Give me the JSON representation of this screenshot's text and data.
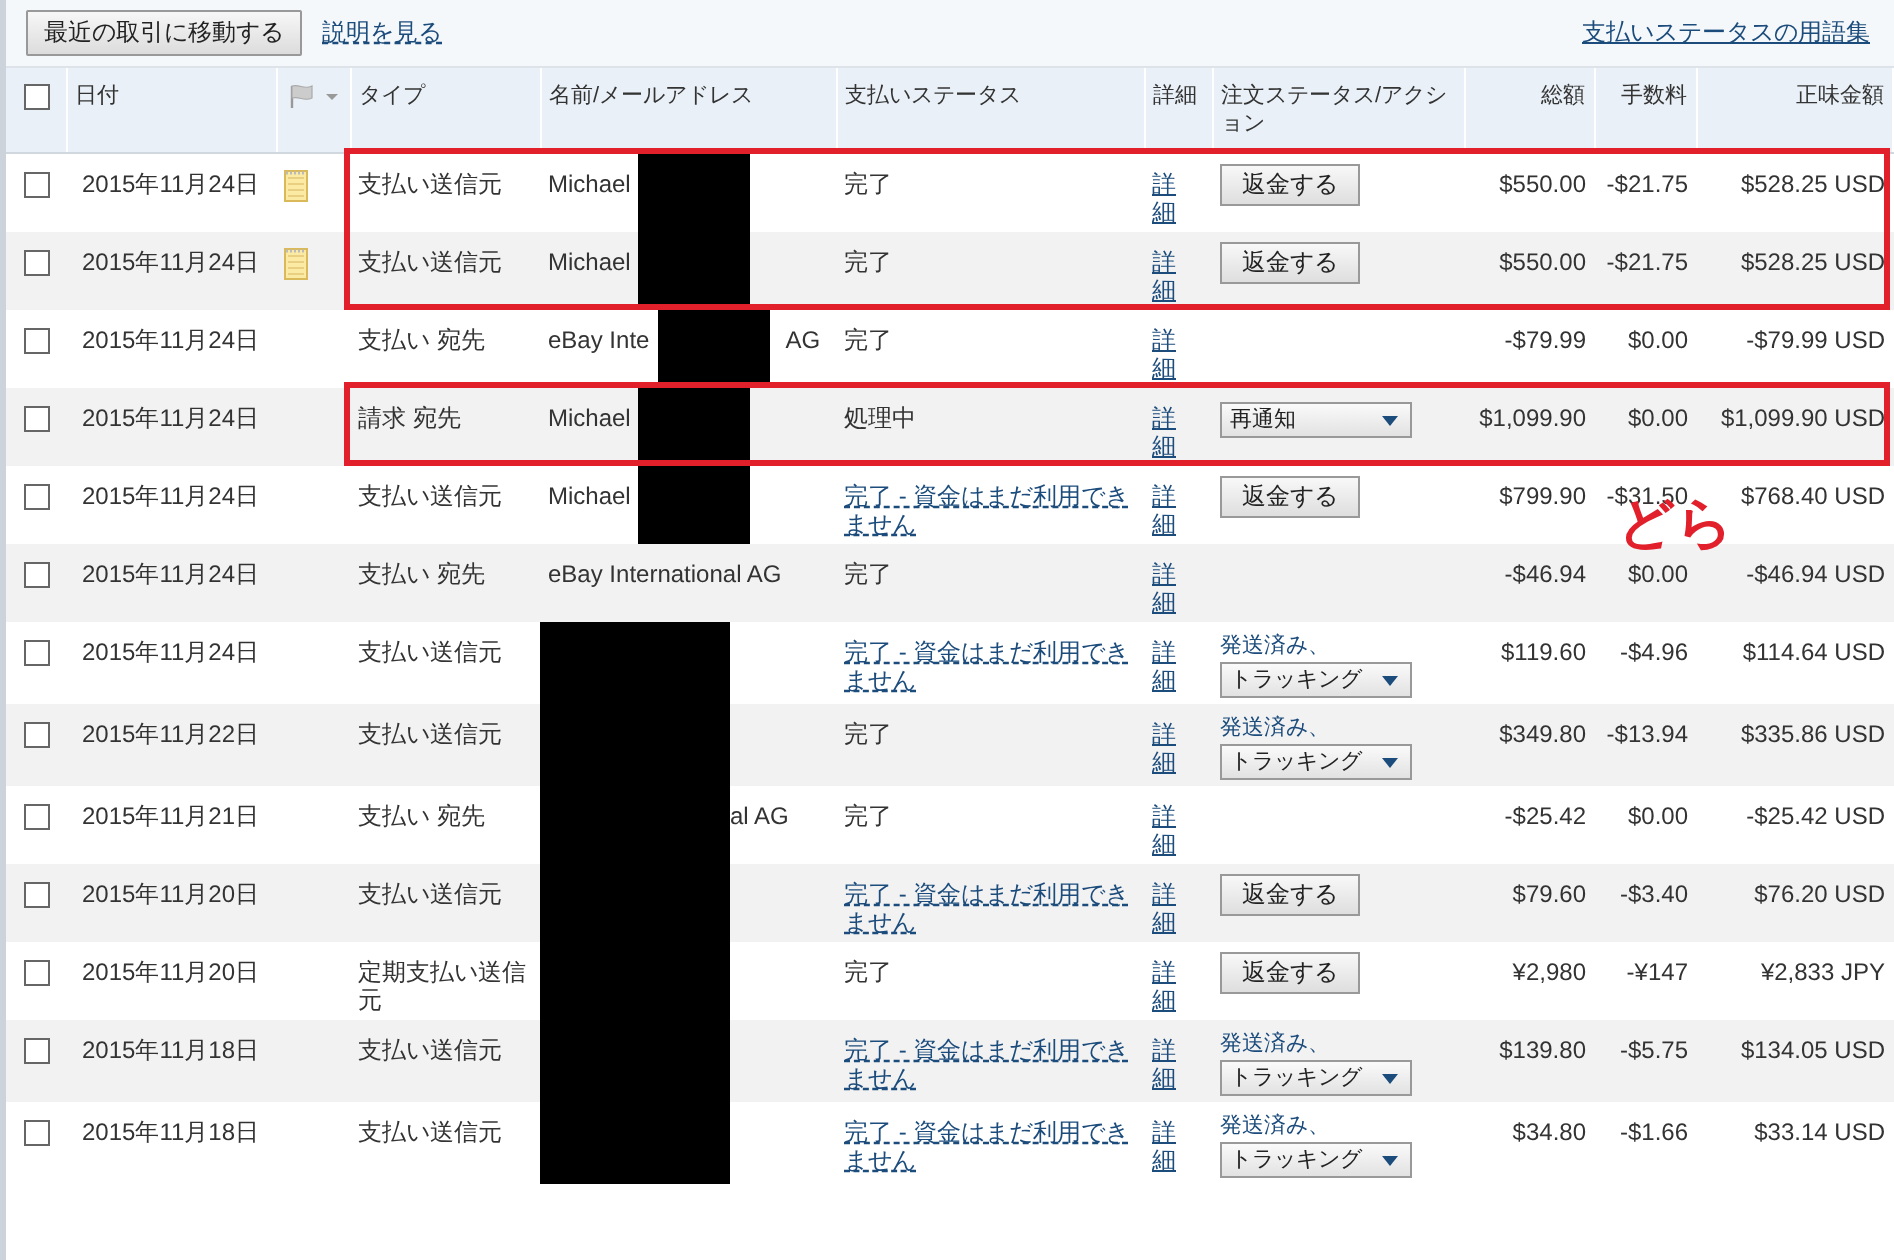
{
  "toolbar": {
    "recent_button": "最近の取引に移動する",
    "help_link": "説明を見る",
    "glossary_link": "支払いステータスの用語集"
  },
  "table": {
    "select_all": {
      "checked": false
    },
    "columns": [
      "日付",
      "タイプ",
      "名前/メールアドレス",
      "支払いステータス",
      "詳細",
      "注文ステータス/アクション",
      "総額",
      "手数料",
      "正味金額"
    ],
    "rows": [
      {
        "highlight": true,
        "checked": false,
        "date": "2015年11月24日",
        "note": true,
        "type": "支払い送信元",
        "name": [
          {
            "kind": "text",
            "text": "Michael"
          },
          {
            "kind": "redacted"
          }
        ],
        "status": {
          "text": "完了",
          "link": false
        },
        "details": "詳細",
        "action": {
          "kind": "button",
          "label": "返金する"
        },
        "gross": "$550.00",
        "fee": "-$21.75",
        "net": "$528.25 USD"
      },
      {
        "highlight": true,
        "checked": false,
        "date": "2015年11月24日",
        "note": true,
        "type": "支払い送信元",
        "name": [
          {
            "kind": "text",
            "text": "Michael"
          },
          {
            "kind": "redacted"
          }
        ],
        "status": {
          "text": "完了",
          "link": false
        },
        "details": "詳細",
        "action": {
          "kind": "button",
          "label": "返金する"
        },
        "gross": "$550.00",
        "fee": "-$21.75",
        "net": "$528.25 USD"
      },
      {
        "highlight": false,
        "checked": false,
        "date": "2015年11月24日",
        "note": false,
        "type": "支払い 宛先",
        "name": [
          {
            "kind": "text",
            "text": "eBay Inte"
          },
          {
            "kind": "redacted"
          },
          {
            "kind": "text",
            "text": "AG"
          }
        ],
        "status": {
          "text": "完了",
          "link": false
        },
        "details": "詳細",
        "gross": "-$79.99",
        "fee": "$0.00",
        "net": "-$79.99 USD"
      },
      {
        "highlight": true,
        "checked": false,
        "date": "2015年11月24日",
        "note": false,
        "type": "請求 宛先",
        "name": [
          {
            "kind": "text",
            "text": "Michael"
          },
          {
            "kind": "redacted"
          }
        ],
        "status": {
          "text": "処理中",
          "link": false
        },
        "details": "詳細",
        "action": {
          "kind": "dropdown",
          "label": "再通知"
        },
        "gross": "$1,099.90",
        "fee": "$0.00",
        "net": "$1,099.90 USD"
      },
      {
        "highlight": false,
        "checked": false,
        "date": "2015年11月24日",
        "note": false,
        "type": "支払い送信元",
        "name": [
          {
            "kind": "text",
            "text": "Michael"
          },
          {
            "kind": "redacted"
          }
        ],
        "status": {
          "text": "完了 - 資金はまだ利用できません",
          "link": true
        },
        "details": "詳細",
        "action": {
          "kind": "button",
          "label": "返金する"
        },
        "gross": "$799.90",
        "fee": "-$31.50",
        "net": "$768.40 USD"
      },
      {
        "highlight": false,
        "checked": false,
        "date": "2015年11月24日",
        "note": false,
        "type": "支払い 宛先",
        "name": [
          {
            "kind": "text",
            "text": "eBay International AG"
          }
        ],
        "status": {
          "text": "完了",
          "link": false
        },
        "details": "詳細",
        "gross": "-$46.94",
        "fee": "$0.00",
        "net": "-$46.94 USD"
      },
      {
        "highlight": false,
        "checked": false,
        "date": "2015年11月24日",
        "note": false,
        "type": "支払い送信元",
        "name": [
          {
            "kind": "redacted"
          }
        ],
        "status": {
          "text": "完了 - 資金はまだ利用できません",
          "link": true
        },
        "details": "詳細",
        "action": {
          "kind": "shipped",
          "label": "発送済み、",
          "select": "トラッキング"
        },
        "gross": "$119.60",
        "fee": "-$4.96",
        "net": "$114.64 USD"
      },
      {
        "highlight": false,
        "checked": false,
        "date": "2015年11月22日",
        "note": false,
        "type": "支払い送信元",
        "name": [
          {
            "kind": "redacted"
          }
        ],
        "status": {
          "text": "完了",
          "link": false
        },
        "details": "詳細",
        "action": {
          "kind": "shipped",
          "label": "発送済み、",
          "select": "トラッキング"
        },
        "gross": "$349.80",
        "fee": "-$13.94",
        "net": "$335.86 USD"
      },
      {
        "highlight": false,
        "checked": false,
        "date": "2015年11月21日",
        "note": false,
        "type": "支払い 宛先",
        "name": [
          {
            "kind": "redacted"
          },
          {
            "kind": "text",
            "text": "al AG"
          }
        ],
        "status": {
          "text": "完了",
          "link": false
        },
        "details": "詳細",
        "gross": "-$25.42",
        "fee": "$0.00",
        "net": "-$25.42 USD"
      },
      {
        "highlight": false,
        "checked": false,
        "date": "2015年11月20日",
        "note": false,
        "type": "支払い送信元",
        "name": [
          {
            "kind": "redacted"
          }
        ],
        "status": {
          "text": "完了 - 資金はまだ利用できません",
          "link": true
        },
        "details": "詳細",
        "action": {
          "kind": "button",
          "label": "返金する"
        },
        "gross": "$79.60",
        "fee": "-$3.40",
        "net": "$76.20 USD"
      },
      {
        "highlight": false,
        "checked": false,
        "date": "2015年11月20日",
        "note": false,
        "type": "定期支払い送信元",
        "name": [
          {
            "kind": "redacted"
          }
        ],
        "status": {
          "text": "完了",
          "link": false
        },
        "details": "詳細",
        "action": {
          "kind": "button",
          "label": "返金する"
        },
        "gross": "¥2,980",
        "fee": "-¥147",
        "net": "¥2,833 JPY"
      },
      {
        "highlight": false,
        "checked": false,
        "date": "2015年11月18日",
        "note": false,
        "type": "支払い送信元",
        "name": [
          {
            "kind": "redacted"
          }
        ],
        "status": {
          "text": "完了 - 資金はまだ利用できません",
          "link": true
        },
        "details": "詳細",
        "action": {
          "kind": "shipped",
          "label": "発送済み、",
          "select": "トラッキング"
        },
        "gross": "$139.80",
        "fee": "-$5.75",
        "net": "$134.05 USD"
      },
      {
        "highlight": false,
        "checked": false,
        "date": "2015年11月18日",
        "note": false,
        "type": "支払い送信元",
        "name": [
          {
            "kind": "redacted"
          }
        ],
        "status": {
          "text": "完了 - 資金はまだ利用できません",
          "link": true
        },
        "details": "詳細",
        "action": {
          "kind": "shipped",
          "label": "発送済み、",
          "select": "トラッキング"
        },
        "gross": "$34.80",
        "fee": "-$1.66",
        "net": "$33.14 USD"
      }
    ]
  },
  "annotation": {
    "text": "どら"
  }
}
